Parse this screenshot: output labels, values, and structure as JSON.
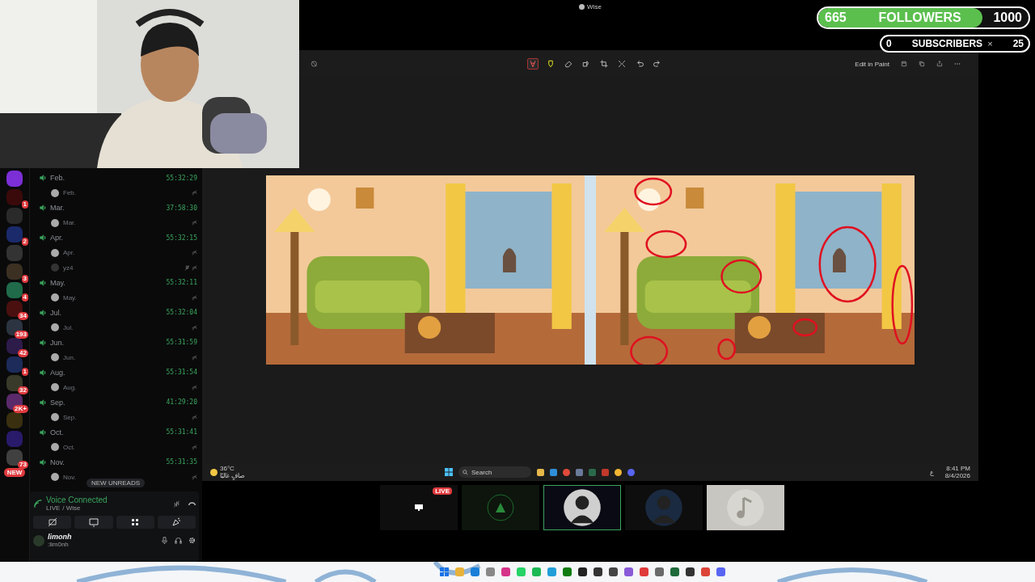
{
  "stream_window": {
    "title": "Wise",
    "edit_button": "Edit in Paint",
    "tools": [
      {
        "kind": "pen",
        "selected": true
      },
      {
        "kind": "highlighter",
        "selected": false
      },
      {
        "kind": "eraser",
        "selected": false
      },
      {
        "kind": "shapes",
        "selected": false
      },
      {
        "kind": "crop",
        "selected": false
      },
      {
        "kind": "adjust",
        "selected": false
      },
      {
        "kind": "undo",
        "selected": false
      },
      {
        "kind": "redo",
        "selected": false
      }
    ]
  },
  "overlay": {
    "followers": {
      "count": "665",
      "label": "FOLLOWERS",
      "goal": "1000",
      "level": 0.78
    },
    "subscribers": {
      "count": "0",
      "label": "SUBSCRIBERS",
      "close": "×",
      "goal": "25"
    }
  },
  "servers": [
    {
      "color": "#7c2fd6"
    },
    {
      "color": "#3a0a0a",
      "badge": "1"
    },
    {
      "color": "#2a2a2a"
    },
    {
      "color": "#1b2a6b",
      "badge": "2"
    },
    {
      "color": "#333333"
    },
    {
      "color": "#3b3022",
      "badge": "3"
    },
    {
      "color": "#1f6b4a",
      "badge": "4"
    },
    {
      "color": "#4a1010",
      "badge": "34"
    },
    {
      "color": "#2b3440",
      "badge": "193"
    },
    {
      "color": "#2d1b4a",
      "badge": "42"
    },
    {
      "color": "#1c2b5a",
      "badge": "1"
    },
    {
      "color": "#3a3a2a",
      "badge": "32"
    },
    {
      "color": "#5a2a6a",
      "badge": "2K+"
    },
    {
      "color": "#3a3010"
    },
    {
      "color": "#2a1a6a"
    },
    {
      "color": "#404040",
      "badge": "73"
    }
  ],
  "new_badge": "NEW",
  "voice_channels": [
    {
      "name": "Feb.",
      "time": "55:32:29",
      "members": [
        {
          "name": "Feb.",
          "kind": "user"
        }
      ]
    },
    {
      "name": "Mar.",
      "time": "37:58:30",
      "members": [
        {
          "name": "Mar.",
          "kind": "user"
        }
      ]
    },
    {
      "name": "Apr.",
      "time": "55:32:15",
      "members": [
        {
          "name": "Apr.",
          "kind": "user"
        },
        {
          "name": "yz4",
          "kind": "muted"
        }
      ]
    },
    {
      "name": "May.",
      "time": "55:32:11",
      "members": [
        {
          "name": "May.",
          "kind": "user"
        }
      ]
    },
    {
      "name": "Jul.",
      "time": "55:32:04",
      "members": [
        {
          "name": "Jul.",
          "kind": "user"
        }
      ]
    },
    {
      "name": "Jun.",
      "time": "55:31:59",
      "members": [
        {
          "name": "Jun.",
          "kind": "user"
        }
      ]
    },
    {
      "name": "Aug.",
      "time": "55:31:54",
      "members": [
        {
          "name": "Aug.",
          "kind": "user"
        }
      ]
    },
    {
      "name": "Sep.",
      "time": "41:29:20",
      "members": [
        {
          "name": "Sep.",
          "kind": "user"
        }
      ]
    },
    {
      "name": "Oct.",
      "time": "55:31:41",
      "members": [
        {
          "name": "Oct.",
          "kind": "user"
        }
      ]
    },
    {
      "name": "Nov.",
      "time": "55:31:35",
      "members": [
        {
          "name": "Nov.",
          "kind": "user"
        }
      ]
    }
  ],
  "new_unreads": "NEW UNREADS",
  "voice_panel": {
    "status": "Voice Connected",
    "live": "LIVE",
    "channel": "/ Wise"
  },
  "user_panel": {
    "name": "limonh",
    "tag": ":lim0nh"
  },
  "stream_taskbar": {
    "temperature": "36°C",
    "weather": "صافٍ غالبًا",
    "search": "Search",
    "lang": "ع",
    "time": "8:41 PM",
    "date": "8/4/2026"
  },
  "stream_tiles": [
    {
      "kind": "screen",
      "live": "LIVE",
      "selected": false
    },
    {
      "kind": "logo",
      "selected": false
    },
    {
      "kind": "avatar",
      "selected": true
    },
    {
      "kind": "avatar",
      "selected": false
    },
    {
      "kind": "music",
      "selected": false
    }
  ]
}
